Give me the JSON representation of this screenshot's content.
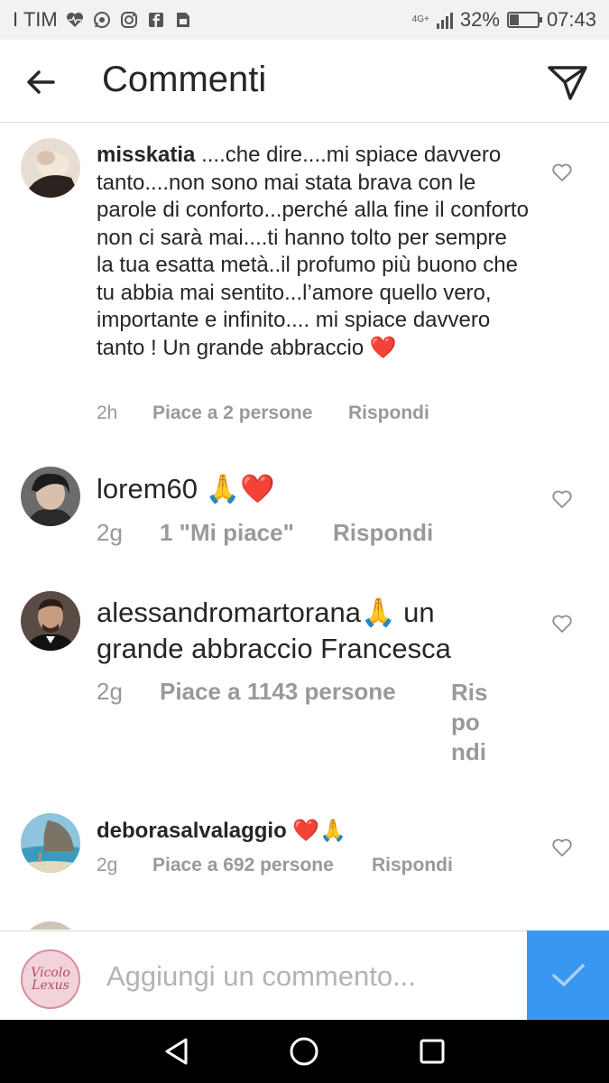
{
  "status_bar": {
    "carrier": "I TIM",
    "icons": [
      "heart-monitor-icon",
      "whatsapp-icon",
      "instagram-icon",
      "facebook-icon",
      "sim-icon"
    ],
    "network": "4G+",
    "battery": "32%",
    "battery_level": 0.32,
    "time": "07:43"
  },
  "header": {
    "title": "Commenti",
    "back_icon": "arrow-left-icon",
    "send_icon": "paper-plane-icon"
  },
  "comments": [
    {
      "username": "misskatia",
      "text": " ....che dire....mi spiace davvero tanto....non sono mai stata brava con le parole di conforto...perché alla fine il conforto non ci sarà mai....ti hanno tolto per sempre la tua esatta metà..il profumo più buono che tu abbia mai sentito...l’amore quello vero, importante e infinito.... mi spiace davvero tanto ! Un grande abbraccio ❤️",
      "time": "2h",
      "likes": "Piace a 2 persone",
      "reply": "Rispondi"
    },
    {
      "username": "lorem60",
      "text": " 🙏❤️",
      "time": "2g",
      "likes": "1 \"Mi piace\"",
      "reply": "Rispondi"
    },
    {
      "username": "alessandromartorana",
      "text": "🙏 un grande abbraccio Francesca",
      "time": "2g",
      "likes": "Piace a 1143 persone",
      "reply": "Ris po ndi"
    },
    {
      "username": "deborasalvalaggio",
      "text": " ❤️🙏",
      "time": "2g",
      "likes": "Piace a 692 persone",
      "reply": "Rispondi"
    }
  ],
  "composer": {
    "placeholder": "Aggiungi un commento...",
    "avatar_text": "Vicolo Lexus",
    "submit_icon": "checkmark-icon",
    "accent": "#3897f0"
  },
  "nav": {
    "icons": [
      "back-triangle-icon",
      "home-circle-icon",
      "recents-square-icon"
    ]
  },
  "colors": {
    "text": "#262626",
    "meta": "#999999",
    "heart_red": "#e0202d"
  }
}
